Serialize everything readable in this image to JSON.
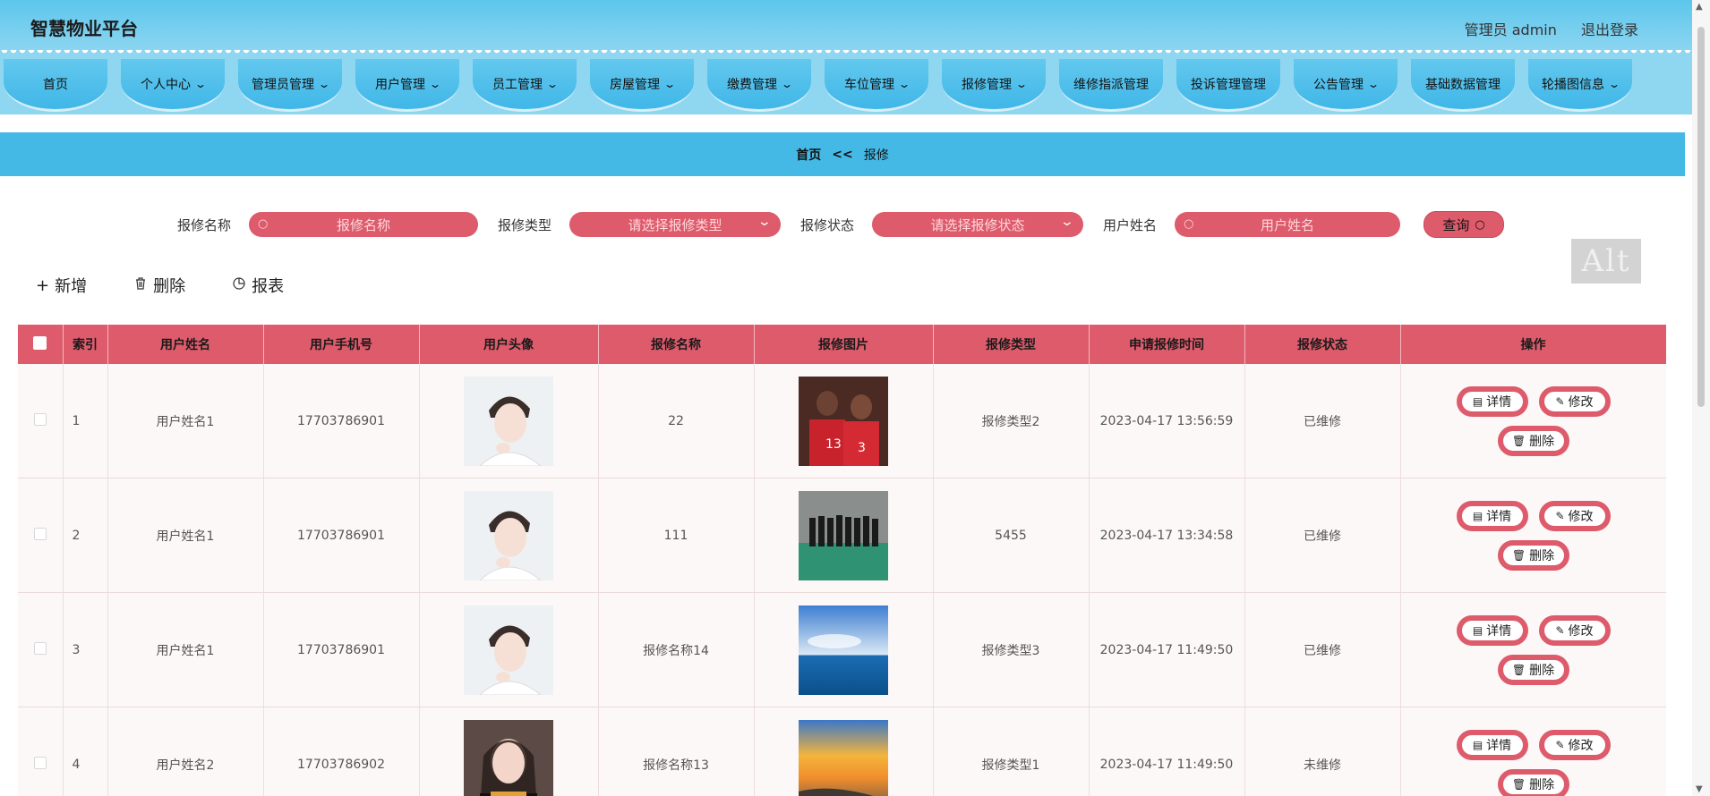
{
  "header": {
    "brand": "智慧物业平台",
    "user_label": "管理员 admin",
    "logout_label": "退出登录"
  },
  "nav": {
    "items": [
      {
        "label": "首页",
        "has_dropdown": false
      },
      {
        "label": "个人中心",
        "has_dropdown": true
      },
      {
        "label": "管理员管理",
        "has_dropdown": true
      },
      {
        "label": "用户管理",
        "has_dropdown": true
      },
      {
        "label": "员工管理",
        "has_dropdown": true
      },
      {
        "label": "房屋管理",
        "has_dropdown": true
      },
      {
        "label": "缴费管理",
        "has_dropdown": true
      },
      {
        "label": "车位管理",
        "has_dropdown": true
      },
      {
        "label": "报修管理",
        "has_dropdown": true
      },
      {
        "label": "维修指派管理",
        "has_dropdown": false
      },
      {
        "label": "投诉管理管理",
        "has_dropdown": false
      },
      {
        "label": "公告管理",
        "has_dropdown": true
      },
      {
        "label": "基础数据管理",
        "has_dropdown": false
      },
      {
        "label": "轮播图信息",
        "has_dropdown": true
      }
    ]
  },
  "breadcrumb": {
    "home": "首页",
    "separator": "<<",
    "current": "报修"
  },
  "search": {
    "name_label": "报修名称",
    "name_placeholder": "报修名称",
    "type_label": "报修类型",
    "type_placeholder": "请选择报修类型",
    "status_label": "报修状态",
    "status_placeholder": "请选择报修状态",
    "username_label": "用户姓名",
    "username_placeholder": "用户姓名",
    "query_label": "查询"
  },
  "alt_badge": "Alt",
  "actions": {
    "add_label": "新增",
    "delete_label": "删除",
    "report_label": "报表"
  },
  "table": {
    "headers": [
      "索引",
      "用户姓名",
      "用户手机号",
      "用户头像",
      "报修名称",
      "报修图片",
      "报修类型",
      "申请报修时间",
      "报修状态",
      "操作"
    ],
    "rows": [
      {
        "index": "1",
        "username": "用户姓名1",
        "phone": "17703786901",
        "repair_name": "22",
        "repair_type": "报修类型2",
        "time": "2023-04-17 13:56:59",
        "status": "已维修",
        "avatar": "male-avatar",
        "photo": "basketball-players"
      },
      {
        "index": "2",
        "username": "用户姓名1",
        "phone": "17703786901",
        "repair_name": "111",
        "repair_type": "5455",
        "time": "2023-04-17 13:34:58",
        "status": "已维修",
        "avatar": "male-avatar",
        "photo": "team-photo"
      },
      {
        "index": "3",
        "username": "用户姓名1",
        "phone": "17703786901",
        "repair_name": "报修名称14",
        "repair_type": "报修类型3",
        "time": "2023-04-17 11:49:50",
        "status": "已维修",
        "avatar": "male-avatar",
        "photo": "ocean-sky"
      },
      {
        "index": "4",
        "username": "用户姓名2",
        "phone": "17703786902",
        "repair_name": "报修名称13",
        "repair_type": "报修类型1",
        "time": "2023-04-17 11:49:50",
        "status": "未维修",
        "avatar": "female-avatar",
        "photo": "sunset-beach"
      }
    ],
    "op_detail": "详情",
    "op_edit": "修改",
    "op_delete": "删除"
  },
  "colors": {
    "accent": "#dd5b6b",
    "header": "#5cc6ec",
    "breadcrumb": "#45b9e6"
  }
}
